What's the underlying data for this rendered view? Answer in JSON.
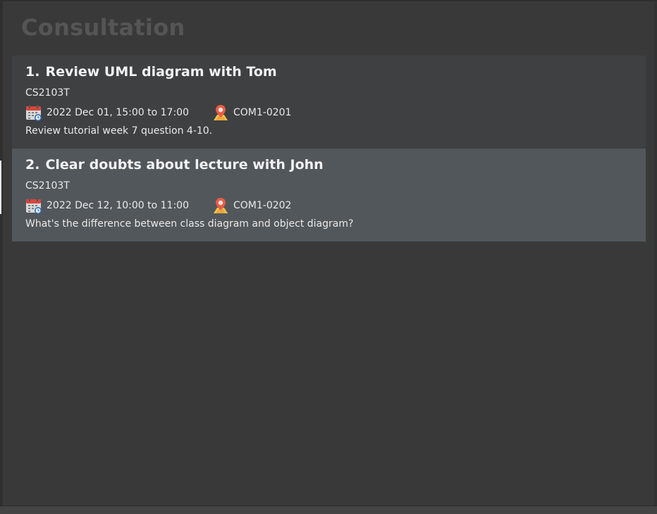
{
  "panel": {
    "title": "Consultation"
  },
  "consultations": [
    {
      "index": "1.",
      "title": "Review UML diagram with Tom",
      "module": "CS2103T",
      "time": "2022 Dec 01, 15:00 to 17:00",
      "venue": "COM1-0201",
      "description": "Review tutorial week 7 question 4-10.",
      "selected": false
    },
    {
      "index": "2.",
      "title": "Clear doubts about lecture with John",
      "module": "CS2103T",
      "time": "2022 Dec 12, 10:00 to 11:00",
      "venue": "COM1-0202",
      "description": "What's the difference between class diagram and object diagram?",
      "selected": true
    }
  ],
  "icons": {
    "time": "calendar-icon",
    "venue": "location-pin-icon"
  },
  "colors": {
    "background": "#393939",
    "card": "#3f4042",
    "card_selected": "#52575b",
    "title_muted": "#555555",
    "text": "#eaeaea"
  }
}
